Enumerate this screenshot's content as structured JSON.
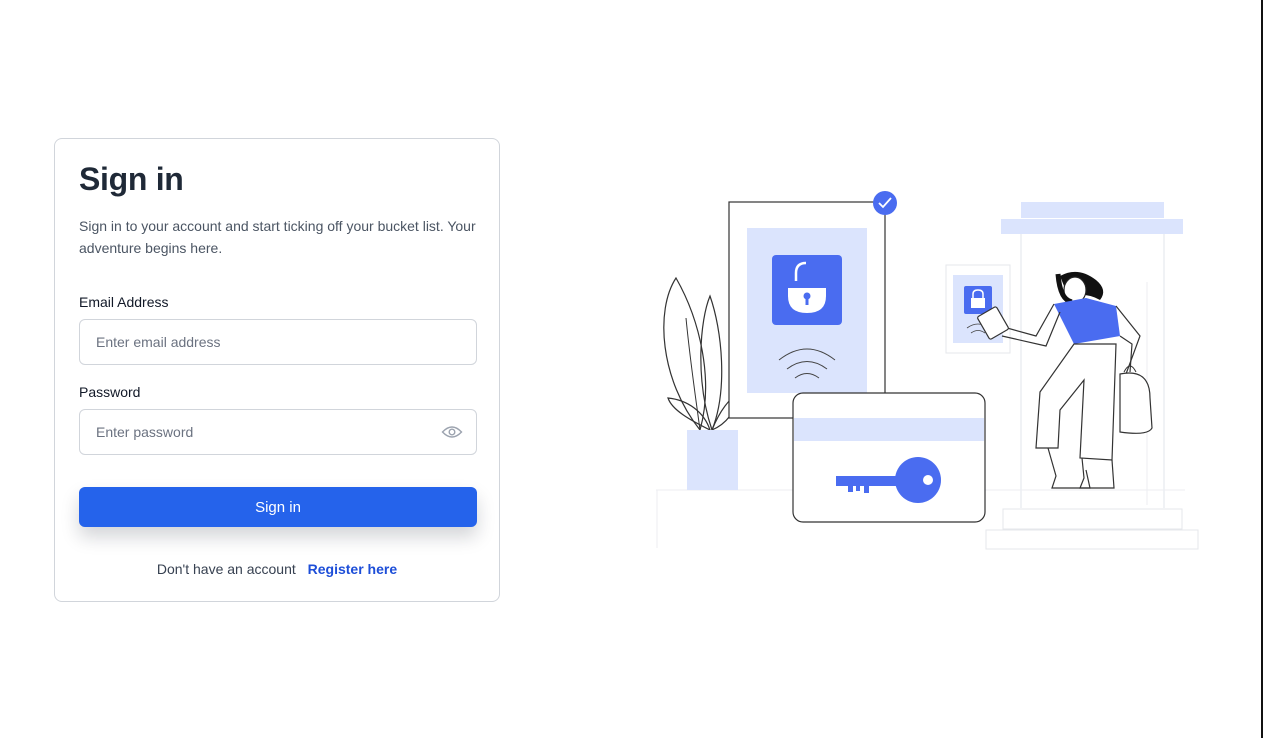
{
  "signin": {
    "title": "Sign in",
    "subtitle": "Sign in to your account and start ticking off your bucket list. Your adventure begins here.",
    "email_label": "Email Address",
    "email_placeholder": "Enter email address",
    "email_value": "",
    "password_label": "Password",
    "password_placeholder": "Enter password",
    "password_value": "",
    "submit_label": "Sign in",
    "footer_text": "Don't have an account",
    "register_link": "Register here"
  },
  "icons": {
    "password_toggle": "eye-icon"
  },
  "colors": {
    "primary": "#2563eb",
    "link": "#1d4ed8",
    "accent_blue": "#4a6cf0",
    "accent_light": "#dbe4fd",
    "text_dark": "#1f2937",
    "text_muted": "#4b5563"
  }
}
